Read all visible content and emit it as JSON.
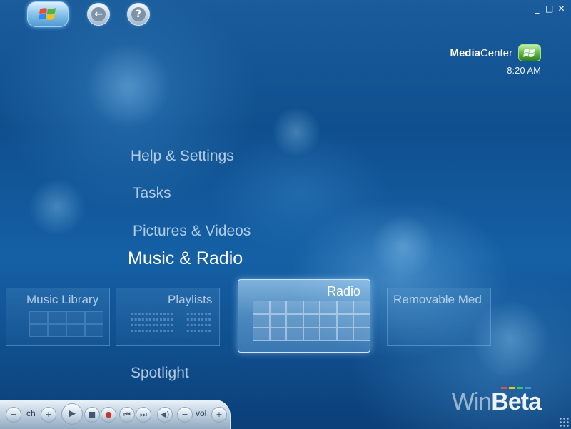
{
  "window": {
    "minimize_label": "_",
    "maximize_label": "□",
    "close_label": "✕"
  },
  "top_nav": {
    "back_glyph": "←",
    "help_glyph": "?"
  },
  "brand": {
    "name_bold": "Media",
    "name_rest": "Center",
    "time": "8:20 AM"
  },
  "menu": {
    "items": [
      "Help & Settings",
      "Tasks",
      "Pictures & Videos",
      "Music & Radio",
      "Spotlight"
    ],
    "selected": "Music & Radio"
  },
  "tiles": [
    {
      "label": "Music Library"
    },
    {
      "label": "Playlists"
    },
    {
      "label": "Radio"
    },
    {
      "label": "Removable Med"
    }
  ],
  "transport": {
    "ch_label": "ch",
    "vol_label": "vol",
    "minus": "−",
    "plus": "+",
    "play": "▶",
    "stop": "■",
    "record": "●",
    "prev": "⏮",
    "next": "⏭",
    "mute": "◀)"
  },
  "watermark": {
    "part1": "Win",
    "part2": "Beta",
    "colors": [
      "#e74c3c",
      "#f1c40f",
      "#2ecc71",
      "#3498db"
    ]
  }
}
